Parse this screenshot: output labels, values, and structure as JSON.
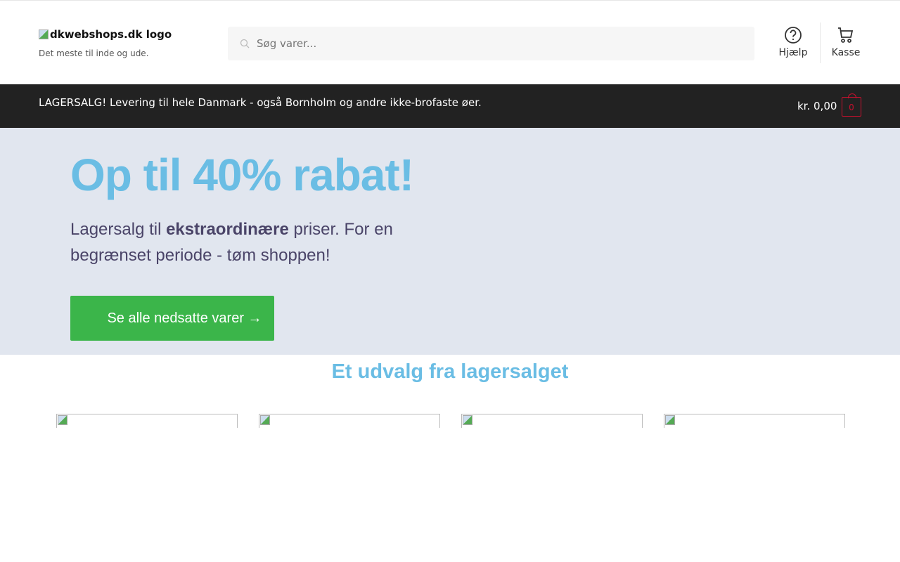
{
  "header": {
    "logo_alt": "dkwebshops.dk logo",
    "tagline": "Det meste til inde og ude.",
    "search_placeholder": "Søg varer...",
    "help_label": "Hjælp",
    "checkout_label": "Kasse"
  },
  "notice_bar": {
    "message": "LAGERSALG! Levering til hele Danmark - også Bornholm og andre ikke-brofaste øer.",
    "cart_total": "kr. 0,00",
    "cart_count": "0"
  },
  "hero": {
    "title": "Op til 40% rabat!",
    "text_before": "Lagersalg til ",
    "text_bold": "ekstraordinære",
    "text_after": " priser. For en begrænset periode - tøm shoppen!",
    "cta": "Se alle nedsatte varer →"
  },
  "section": {
    "title": "Et udvalg fra lagersalget"
  },
  "colors": {
    "accent": "#6abde4",
    "cta": "#3bb54a",
    "bar": "#222222",
    "cart": "#c8102e"
  }
}
